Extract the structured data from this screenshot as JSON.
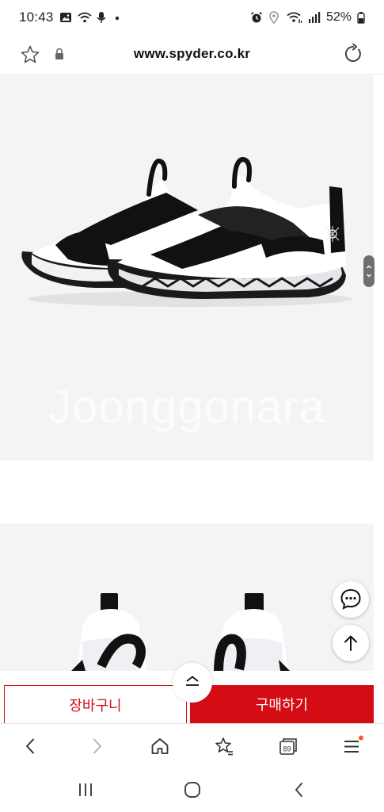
{
  "status_bar": {
    "time": "10:43",
    "battery": "52%",
    "icons_left": [
      "gallery-icon",
      "wifi-call-icon",
      "mic-icon",
      "dot-icon"
    ],
    "icons_right": [
      "alarm-icon",
      "location-icon",
      "wifi-icon",
      "signal-icon",
      "battery-icon"
    ]
  },
  "url_bar": {
    "url": "www.spyder.co.kr"
  },
  "content": {
    "watermark": "Joonggonara",
    "brand_on_shoe": "SPYDER"
  },
  "buy_bar": {
    "cart_label": "장바구니",
    "buy_label": "구매하기"
  },
  "browser_nav": {
    "tabs_count": "89"
  },
  "colors": {
    "accent": "#d40c14",
    "product_bg": "#f4f4f4",
    "notification_dot": "#ff5a1f"
  }
}
